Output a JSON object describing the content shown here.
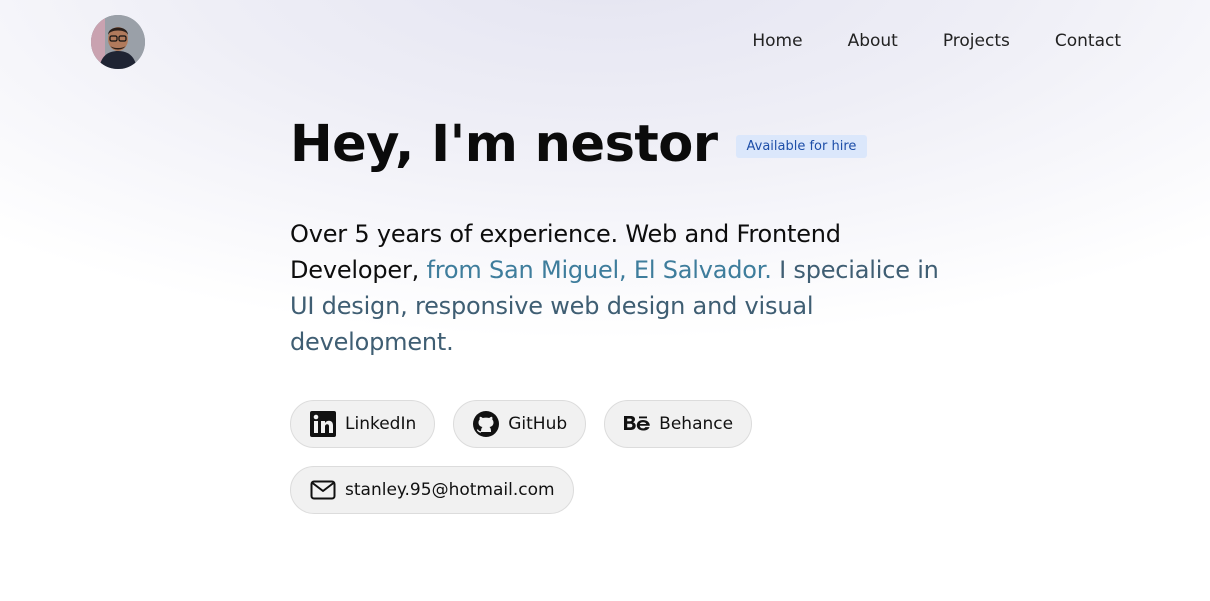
{
  "nav": {
    "items": [
      {
        "label": "Home"
      },
      {
        "label": "About"
      },
      {
        "label": "Projects"
      },
      {
        "label": "Contact"
      }
    ]
  },
  "hero": {
    "title": "Hey, I'm nestor",
    "badge": "Available for hire",
    "intro_dark": "Over 5 years of experience. Web and Frontend Developer, ",
    "intro_blue": "from San Miguel, El Salvador.",
    "intro_slate": " I specialice in UI design, responsive web design and visual development."
  },
  "socials": [
    {
      "label": "LinkedIn",
      "icon": "linkedin-icon"
    },
    {
      "label": "GitHub",
      "icon": "github-icon"
    },
    {
      "label": "Behance",
      "icon": "behance-icon"
    }
  ],
  "contact": {
    "email": "stanley.95@hotmail.com",
    "icon": "mail-icon"
  },
  "colors": {
    "badge_bg": "#dbe7fb",
    "badge_text": "#1d4ea8",
    "accent_blue": "#3e7d9c",
    "accent_slate": "#3f5e73"
  }
}
